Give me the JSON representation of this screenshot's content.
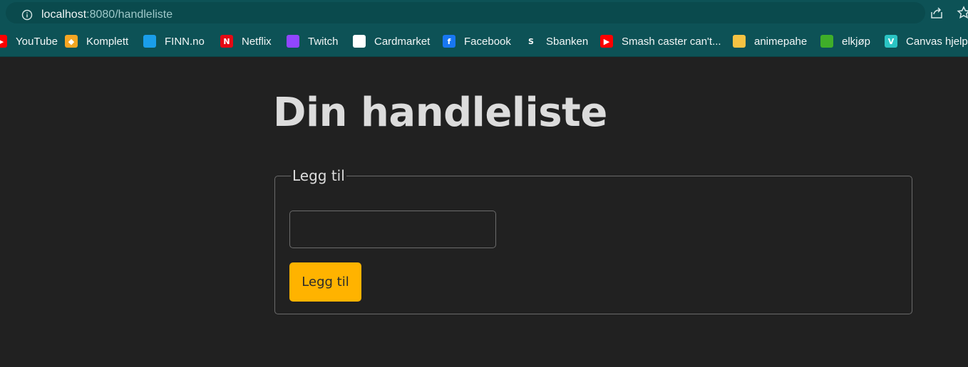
{
  "browser": {
    "url_host": "localhost",
    "url_rest": ":8080/handleliste",
    "icons": {
      "info": "info-icon",
      "share": "share-icon",
      "star": "star-icon"
    }
  },
  "bookmarks": [
    {
      "label": "YouTube",
      "icon": "youtube-icon",
      "color": "#ff0000",
      "glyph": "▶"
    },
    {
      "label": "Komplett",
      "icon": "komplett-icon",
      "color": "#f5a623",
      "glyph": "◆"
    },
    {
      "label": "FINN.no",
      "icon": "finn-icon",
      "color": "#1a9eea",
      "glyph": ""
    },
    {
      "label": "Netflix",
      "icon": "netflix-icon",
      "color": "#e50914",
      "glyph": "N"
    },
    {
      "label": "Twitch",
      "icon": "twitch-icon",
      "color": "#9146ff",
      "glyph": ""
    },
    {
      "label": "Cardmarket",
      "icon": "cardmarket-icon",
      "color": "#ffffff",
      "glyph": ""
    },
    {
      "label": "Facebook",
      "icon": "facebook-icon",
      "color": "#1877f2",
      "glyph": "f"
    },
    {
      "label": "Sbanken",
      "icon": "sbanken-icon",
      "color": "#0d5256",
      "glyph": "S"
    },
    {
      "label": "Smash caster can't...",
      "icon": "youtube-icon",
      "color": "#ff0000",
      "glyph": "▶"
    },
    {
      "label": "animepahe",
      "icon": "animepahe-icon",
      "color": "#f6c343",
      "glyph": ""
    },
    {
      "label": "elkjøp",
      "icon": "elkjop-icon",
      "color": "#3fae29",
      "glyph": ""
    },
    {
      "label": "Canvas hjelpe",
      "icon": "canvas-icon",
      "color": "#2bc4c4",
      "glyph": "V"
    }
  ],
  "page": {
    "title": "Din handleliste",
    "form": {
      "legend": "Legg til",
      "input_value": "",
      "button_label": "Legg til"
    }
  },
  "colors": {
    "browser_chrome": "#0d5256",
    "page_background": "#212121",
    "accent_button": "#ffb300",
    "text": "#dcdcdc"
  }
}
